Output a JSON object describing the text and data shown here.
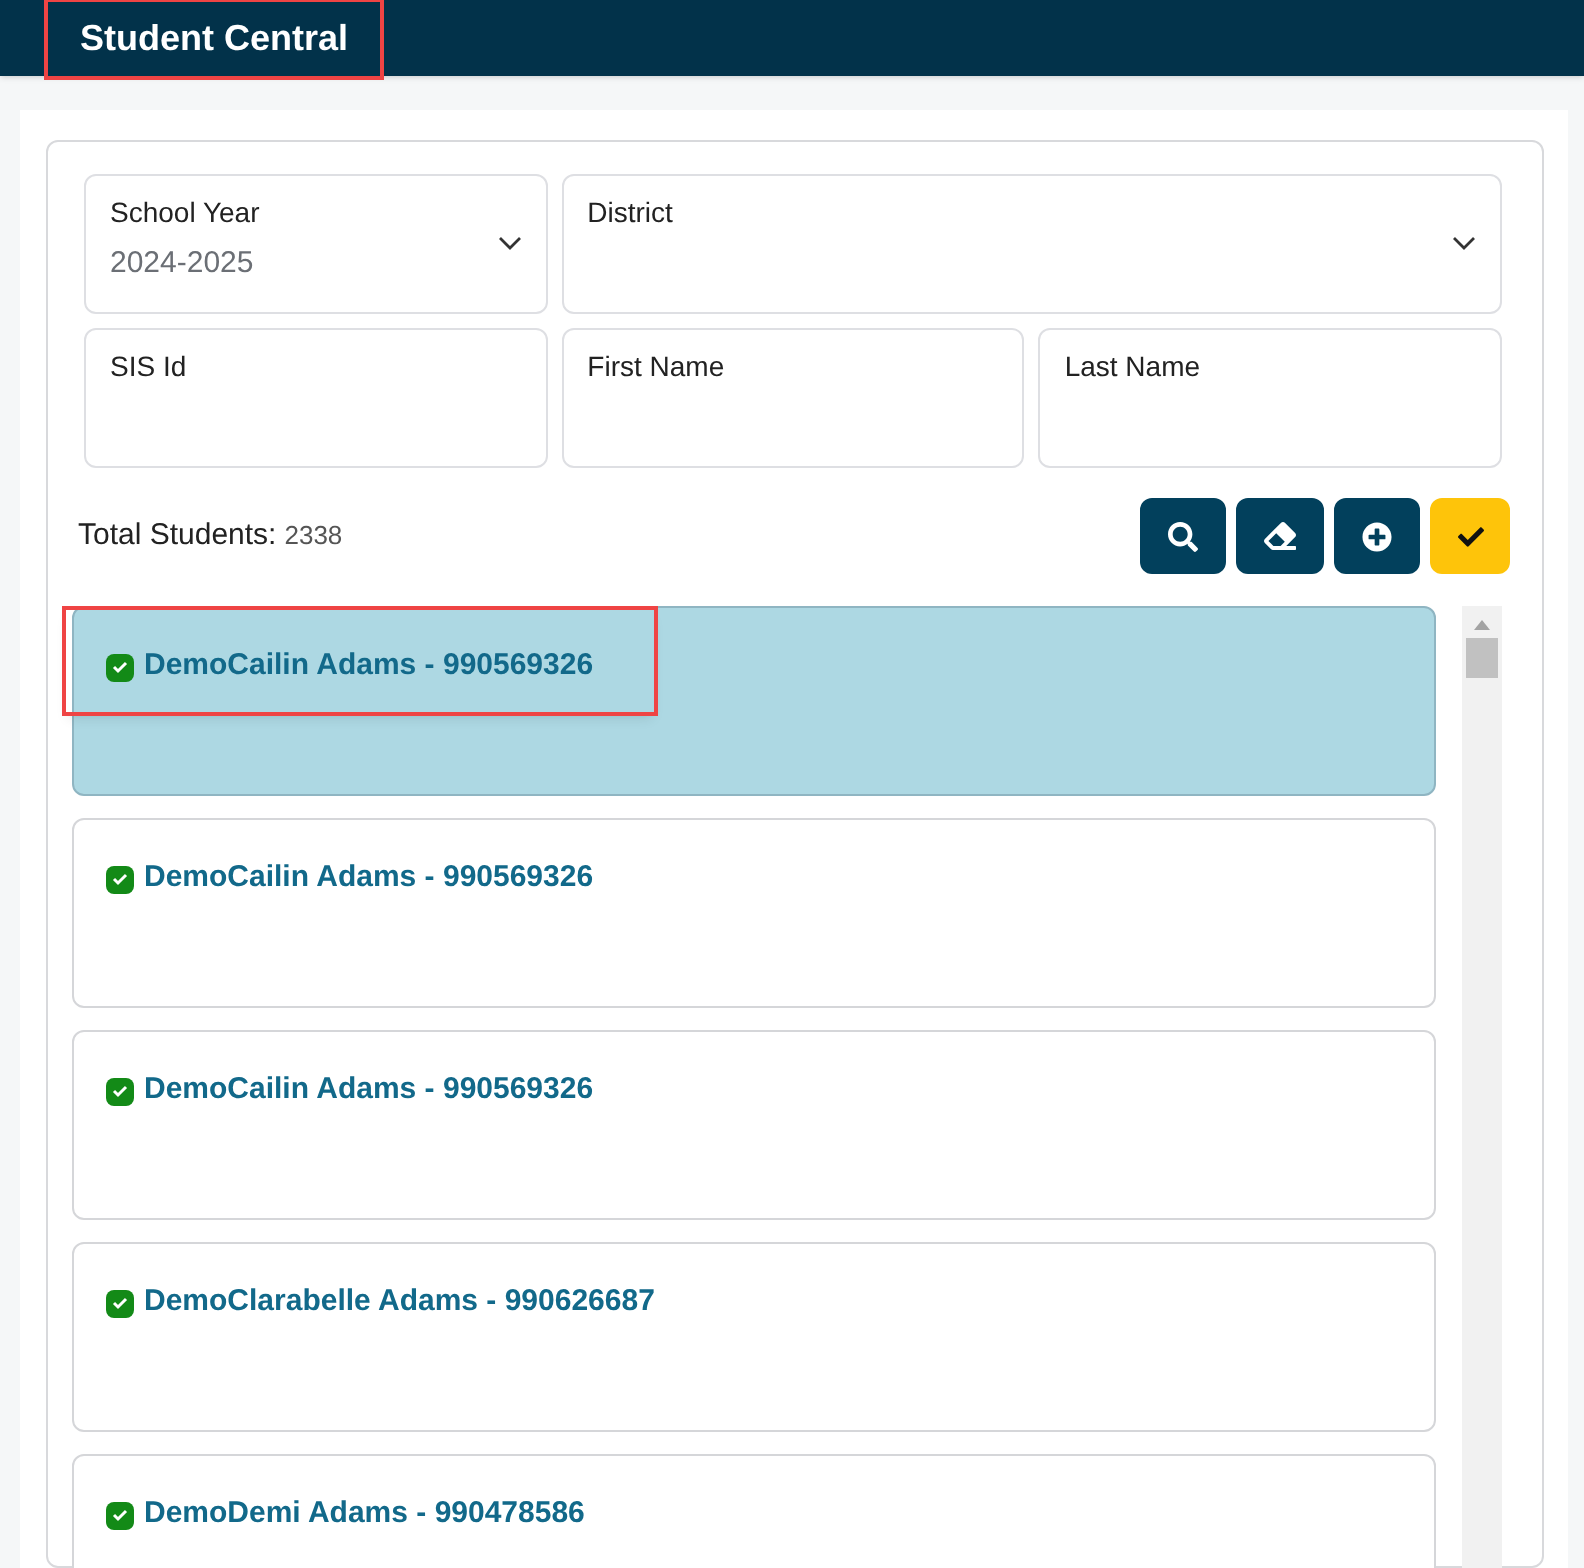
{
  "header": {
    "title": "Student Central",
    "highlighted": true
  },
  "filters": [
    {
      "kind": "select",
      "label": "School Year",
      "value": "2024-2025"
    },
    {
      "kind": "select",
      "label": "District"
    },
    {
      "kind": "text",
      "label": "SIS Id"
    },
    {
      "kind": "text",
      "label": "First Name"
    },
    {
      "kind": "text",
      "label": "Last Name"
    }
  ],
  "total": {
    "label": "Total Students:",
    "count": "2338"
  },
  "students": [
    {
      "name": "DemoCailin Adams - 990569326",
      "checked": true,
      "selected": true,
      "highlighted": true
    },
    {
      "name": "DemoCailin Adams - 990569326",
      "checked": true,
      "selected": false,
      "highlighted": false
    },
    {
      "name": "DemoCailin Adams - 990569326",
      "checked": true,
      "selected": false,
      "highlighted": false
    },
    {
      "name": "DemoClarabelle Adams - 990626687",
      "checked": true,
      "selected": false,
      "highlighted": false
    },
    {
      "name": "DemoDemi Adams - 990478586",
      "checked": true,
      "selected": false,
      "highlighted": false
    }
  ]
}
